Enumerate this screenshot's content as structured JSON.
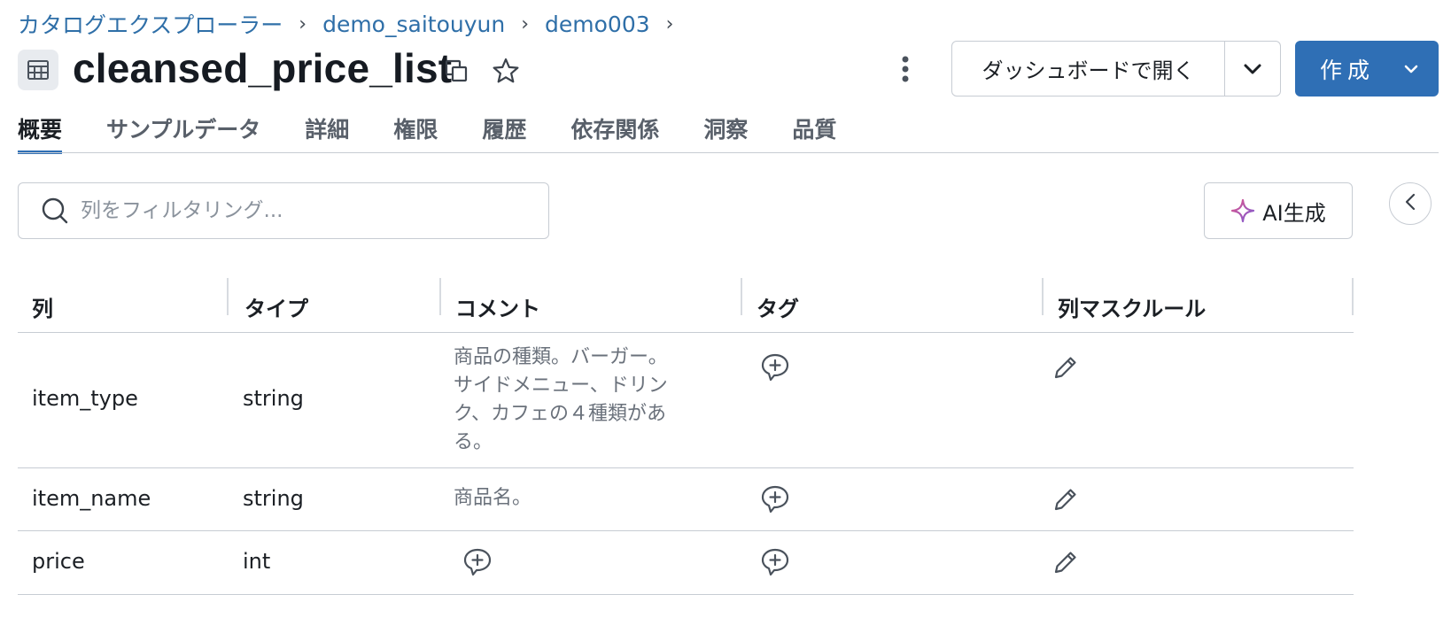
{
  "breadcrumb": {
    "items": [
      "カタログエクスプローラー",
      "demo_saitouyun",
      "demo003"
    ],
    "separator": "›"
  },
  "header": {
    "title": "cleansed_price_list",
    "dashboard_label": "ダッシュボードで開く",
    "create_label": "作成"
  },
  "tabs": [
    {
      "label": "概要",
      "active": true
    },
    {
      "label": "サンプルデータ"
    },
    {
      "label": "詳細"
    },
    {
      "label": "権限"
    },
    {
      "label": "履歴"
    },
    {
      "label": "依存関係"
    },
    {
      "label": "洞察"
    },
    {
      "label": "品質"
    }
  ],
  "search": {
    "placeholder": "列をフィルタリング..."
  },
  "ai_button": {
    "label": "AI生成"
  },
  "table": {
    "headers": [
      "列",
      "タイプ",
      "コメント",
      "タグ",
      "列マスクルール"
    ],
    "rows": [
      {
        "column": "item_type",
        "type": "string",
        "comment": "商品の種類。バーガー。サイドメニュー、ドリンク、カフェの４種類がある。"
      },
      {
        "column": "item_name",
        "type": "string",
        "comment": "商品名。"
      },
      {
        "column": "price",
        "type": "int",
        "comment": ""
      }
    ]
  },
  "icons": {
    "table": "table-icon",
    "copy": "copy-icon",
    "favorite": "star-icon",
    "more": "kebab-menu-icon",
    "search": "search-icon",
    "ai": "sparkle-icon",
    "collapse": "chevron-left-icon",
    "add_comment": "comment-plus-icon",
    "add_tag": "comment-plus-icon",
    "edit_mask": "pencil-icon"
  },
  "colors": {
    "accent": "#2f6fb5",
    "breadcrumb_link": "#2f6fa8",
    "border": "#c7ccd3",
    "muted_text": "#6a717b"
  }
}
